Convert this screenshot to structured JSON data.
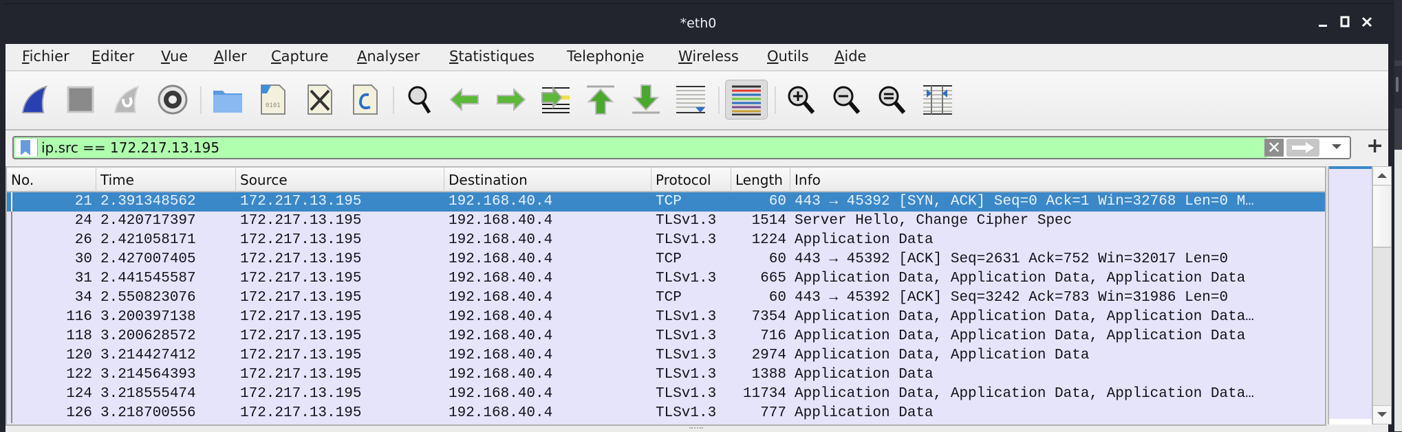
{
  "window": {
    "title": "*eth0",
    "controls": [
      "minimize",
      "maximize",
      "close"
    ]
  },
  "menu": [
    {
      "label": "Fichier",
      "mnemonic": "F"
    },
    {
      "label": "Editer",
      "mnemonic": "E"
    },
    {
      "label": "Vue",
      "mnemonic": "V"
    },
    {
      "label": "Aller",
      "mnemonic": "A"
    },
    {
      "label": "Capture",
      "mnemonic": "C"
    },
    {
      "label": "Analyser",
      "mnemonic": "A"
    },
    {
      "label": "Statistiques",
      "mnemonic": "S"
    },
    {
      "label": "Telephonie",
      "mnemonic": "i"
    },
    {
      "label": "Wireless",
      "mnemonic": "W"
    },
    {
      "label": "Outils",
      "mnemonic": "O"
    },
    {
      "label": "Aide",
      "mnemonic": "A"
    }
  ],
  "toolbar": [
    "start-capture-icon",
    "stop-capture-icon",
    "restart-capture-icon",
    "capture-options-icon",
    "open-file-icon",
    "save-file-icon",
    "close-file-icon",
    "reload-file-icon",
    "find-packet-icon",
    "go-back-icon",
    "go-forward-icon",
    "go-to-packet-icon",
    "go-first-packet-icon",
    "go-last-packet-icon",
    "autoscroll-icon",
    "colorize-icon",
    "zoom-in-icon",
    "zoom-out-icon",
    "zoom-normal-icon",
    "resize-columns-icon"
  ],
  "filter": {
    "value": "ip.src == 172.217.13.195",
    "valid_color": "#afffaf",
    "add_button": "+"
  },
  "packet_list": {
    "columns": [
      "No.",
      "Time",
      "Source",
      "Destination",
      "Protocol",
      "Length",
      "Info"
    ],
    "selected_index": 0,
    "selected_color": "#3b88c8",
    "row_color": "#e6e4fa",
    "rows": [
      {
        "no": "21",
        "time": "2.391348562",
        "source": "172.217.13.195",
        "destination": "192.168.40.4",
        "protocol": "TCP",
        "length": "60",
        "info": "443 → 45392 [SYN, ACK] Seq=0 Ack=1 Win=32768 Len=0 M…"
      },
      {
        "no": "24",
        "time": "2.420717397",
        "source": "172.217.13.195",
        "destination": "192.168.40.4",
        "protocol": "TLSv1.3",
        "length": "1514",
        "info": "Server Hello, Change Cipher Spec"
      },
      {
        "no": "26",
        "time": "2.421058171",
        "source": "172.217.13.195",
        "destination": "192.168.40.4",
        "protocol": "TLSv1.3",
        "length": "1224",
        "info": "Application Data"
      },
      {
        "no": "30",
        "time": "2.427007405",
        "source": "172.217.13.195",
        "destination": "192.168.40.4",
        "protocol": "TCP",
        "length": "60",
        "info": "443 → 45392 [ACK] Seq=2631 Ack=752 Win=32017 Len=0"
      },
      {
        "no": "31",
        "time": "2.441545587",
        "source": "172.217.13.195",
        "destination": "192.168.40.4",
        "protocol": "TLSv1.3",
        "length": "665",
        "info": "Application Data, Application Data, Application Data"
      },
      {
        "no": "34",
        "time": "2.550823076",
        "source": "172.217.13.195",
        "destination": "192.168.40.4",
        "protocol": "TCP",
        "length": "60",
        "info": "443 → 45392 [ACK] Seq=3242 Ack=783 Win=31986 Len=0"
      },
      {
        "no": "116",
        "time": "3.200397138",
        "source": "172.217.13.195",
        "destination": "192.168.40.4",
        "protocol": "TLSv1.3",
        "length": "7354",
        "info": "Application Data, Application Data, Application Data…"
      },
      {
        "no": "118",
        "time": "3.200628572",
        "source": "172.217.13.195",
        "destination": "192.168.40.4",
        "protocol": "TLSv1.3",
        "length": "716",
        "info": "Application Data, Application Data, Application Data"
      },
      {
        "no": "120",
        "time": "3.214427412",
        "source": "172.217.13.195",
        "destination": "192.168.40.4",
        "protocol": "TLSv1.3",
        "length": "2974",
        "info": "Application Data, Application Data"
      },
      {
        "no": "122",
        "time": "3.214564393",
        "source": "172.217.13.195",
        "destination": "192.168.40.4",
        "protocol": "TLSv1.3",
        "length": "1388",
        "info": "Application Data"
      },
      {
        "no": "124",
        "time": "3.218555474",
        "source": "172.217.13.195",
        "destination": "192.168.40.4",
        "protocol": "TLSv1.3",
        "length": "11734",
        "info": "Application Data, Application Data, Application Data…"
      },
      {
        "no": "126",
        "time": "3.218700556",
        "source": "172.217.13.195",
        "destination": "192.168.40.4",
        "protocol": "TLSv1.3",
        "length": "777",
        "info": "Application Data"
      }
    ]
  }
}
